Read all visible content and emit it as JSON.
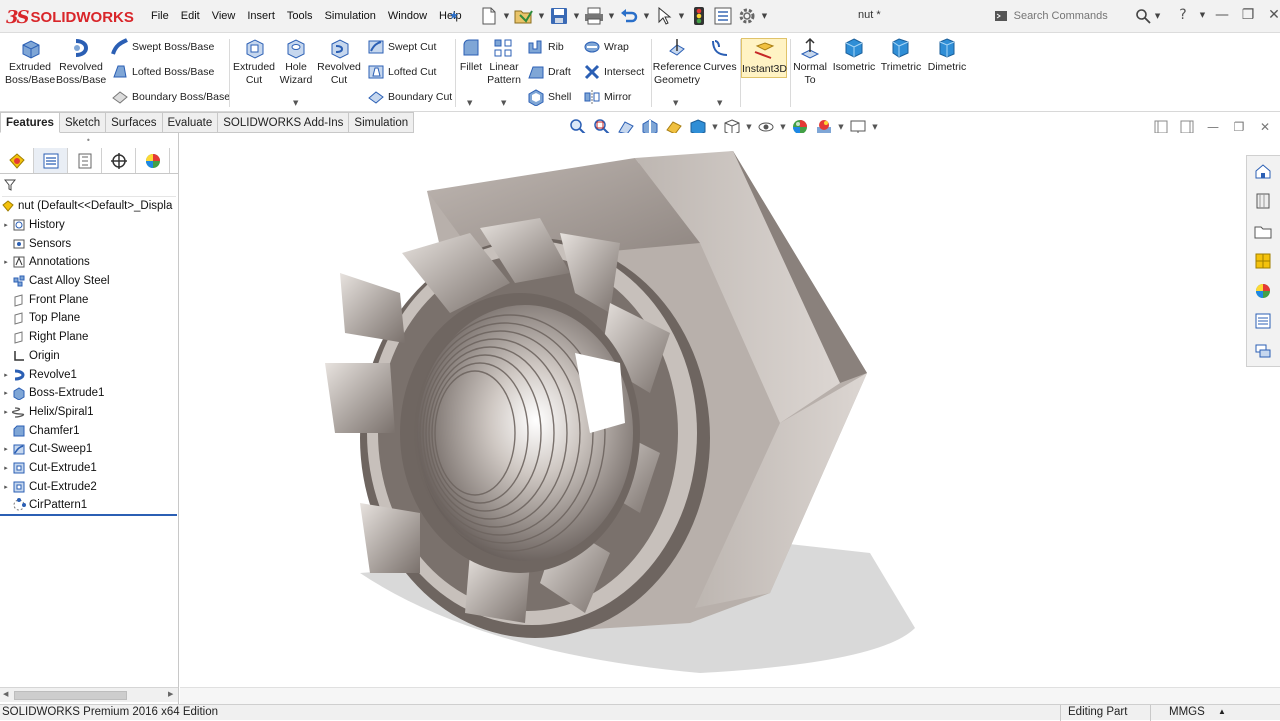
{
  "app": {
    "brand_ds": "3S",
    "brand_name": "SOLIDWORKS",
    "document_title": "nut *"
  },
  "menu": [
    "File",
    "Edit",
    "View",
    "Insert",
    "Tools",
    "Simulation",
    "Window",
    "Help"
  ],
  "search": {
    "placeholder": "Search Commands"
  },
  "help": {
    "label": "?"
  },
  "command_manager": {
    "extruded_boss": "Extruded\nBoss/Base",
    "revolved_boss": "Revolved\nBoss/Base",
    "swept_boss": "Swept Boss/Base",
    "lofted_boss": "Lofted Boss/Base",
    "boundary_boss": "Boundary Boss/Base",
    "extruded_cut": "Extruded\nCut",
    "hole_wizard": "Hole\nWizard",
    "revolved_cut": "Revolved\nCut",
    "swept_cut": "Swept Cut",
    "lofted_cut": "Lofted Cut",
    "boundary_cut": "Boundary Cut",
    "fillet": "Fillet",
    "linear_pattern": "Linear\nPattern",
    "rib": "Rib",
    "draft": "Draft",
    "shell": "Shell",
    "wrap": "Wrap",
    "intersect": "Intersect",
    "mirror": "Mirror",
    "reference_geometry": "Reference\nGeometry",
    "curves": "Curves",
    "instant3d": "Instant3D",
    "normal_to": "Normal\nTo",
    "isometric": "Isometric",
    "trimetric": "Trimetric",
    "dimetric": "Dimetric"
  },
  "tabs": [
    "Features",
    "Sketch",
    "Surfaces",
    "Evaluate",
    "SOLIDWORKS Add-Ins",
    "Simulation"
  ],
  "feature_tree": {
    "root": "nut  (Default<<Default>_Displa",
    "items": [
      {
        "label": "History",
        "expandable": true,
        "icon": "history-icon"
      },
      {
        "label": "Sensors",
        "expandable": false,
        "icon": "sensors-icon"
      },
      {
        "label": "Annotations",
        "expandable": true,
        "icon": "annotations-icon"
      },
      {
        "label": "Cast Alloy Steel",
        "expandable": false,
        "icon": "material-icon"
      },
      {
        "label": "Front Plane",
        "expandable": false,
        "icon": "plane-icon"
      },
      {
        "label": "Top Plane",
        "expandable": false,
        "icon": "plane-icon"
      },
      {
        "label": "Right Plane",
        "expandable": false,
        "icon": "plane-icon"
      },
      {
        "label": "Origin",
        "expandable": false,
        "icon": "origin-icon"
      },
      {
        "label": "Revolve1",
        "expandable": true,
        "icon": "revolve-icon"
      },
      {
        "label": "Boss-Extrude1",
        "expandable": true,
        "icon": "extrude-icon"
      },
      {
        "label": "Helix/Spiral1",
        "expandable": true,
        "icon": "helix-icon"
      },
      {
        "label": "Chamfer1",
        "expandable": false,
        "icon": "chamfer-icon"
      },
      {
        "label": "Cut-Sweep1",
        "expandable": true,
        "icon": "cut-sweep-icon"
      },
      {
        "label": "Cut-Extrude1",
        "expandable": true,
        "icon": "cut-extrude-icon"
      },
      {
        "label": "Cut-Extrude2",
        "expandable": true,
        "icon": "cut-extrude-icon"
      },
      {
        "label": "CirPattern1",
        "expandable": false,
        "icon": "circular-pattern-icon"
      }
    ]
  },
  "status": {
    "edition": "SOLIDWORKS Premium 2016 x64 Edition",
    "mode": "Editing Part",
    "units": "MMGS"
  },
  "colors": {
    "brand_red": "#d9262a",
    "accent_blue": "#2b5fb4",
    "metal_light": "#d6d0cc",
    "metal_dark": "#6c625d"
  }
}
